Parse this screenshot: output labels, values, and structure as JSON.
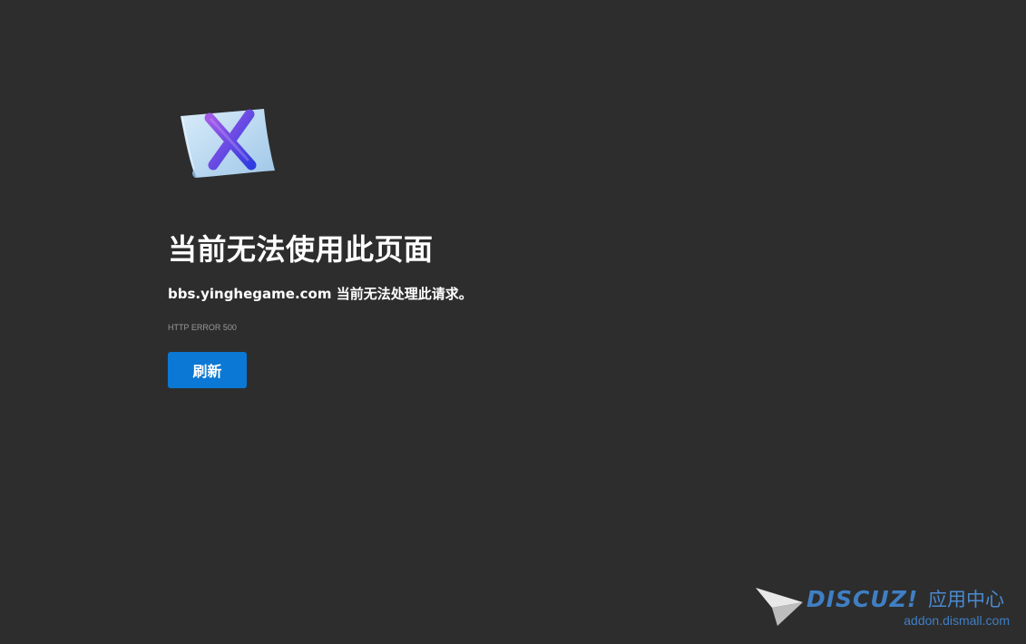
{
  "error_page": {
    "title": "当前无法使用此页面",
    "message": "bbs.yinghegame.com 当前无法处理此请求。",
    "error_code": "HTTP ERROR 500",
    "reload_label": "刷新"
  },
  "icons": {
    "illustration": "error-document-x-icon",
    "watermark_mark": "paper-plane-icon"
  },
  "watermark": {
    "logo": "DISCUZ!",
    "suffix": "应用中心",
    "url": "addon.dismall.com"
  },
  "colors": {
    "background": "#2d2d2d",
    "button": "#0a78d4",
    "watermark": "#3f7fc4"
  }
}
